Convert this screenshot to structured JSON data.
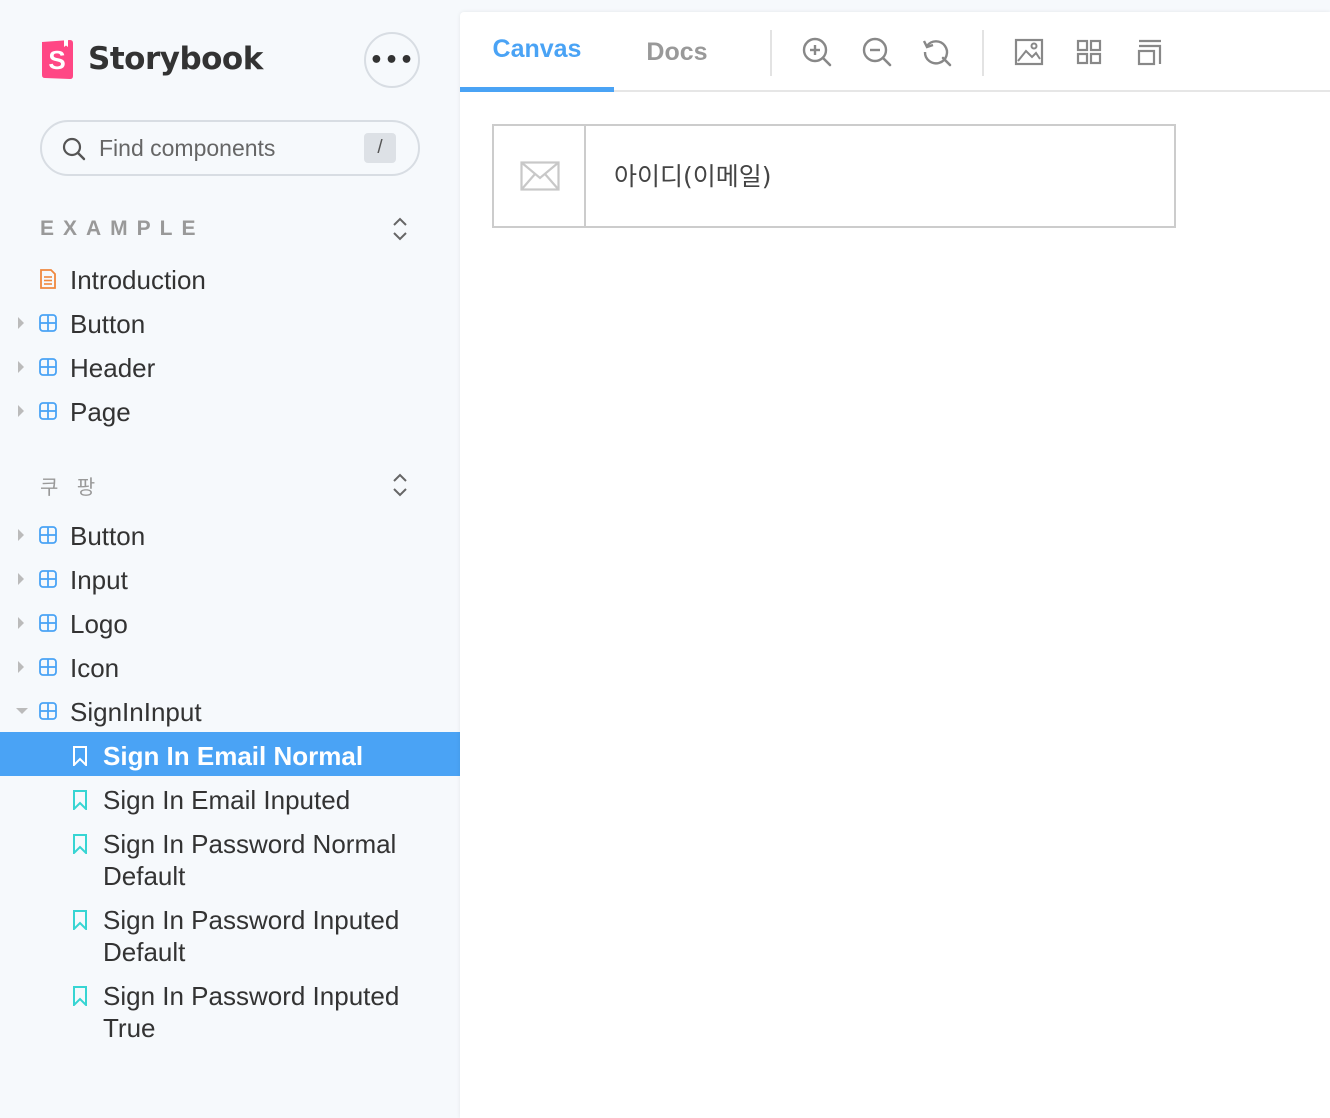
{
  "brand": {
    "name": "Storybook",
    "accent": "#ff4785"
  },
  "search": {
    "placeholder": "Find components",
    "shortcut": "/"
  },
  "groups": [
    {
      "title": "EXAMPLE",
      "items": [
        {
          "label": "Introduction",
          "type": "doc"
        },
        {
          "label": "Button",
          "type": "component"
        },
        {
          "label": "Header",
          "type": "component"
        },
        {
          "label": "Page",
          "type": "component"
        }
      ]
    },
    {
      "title": "쿠 팡",
      "items": [
        {
          "label": "Button",
          "type": "component"
        },
        {
          "label": "Input",
          "type": "component"
        },
        {
          "label": "Logo",
          "type": "component"
        },
        {
          "label": "Icon",
          "type": "component"
        },
        {
          "label": "SignInInput",
          "type": "component",
          "expanded": true
        }
      ]
    }
  ],
  "stories": [
    {
      "label": "Sign In Email Normal",
      "selected": true
    },
    {
      "label": "Sign In Email Inputed"
    },
    {
      "label": "Sign In Password Normal Default"
    },
    {
      "label": "Sign In Password Inputed Default"
    },
    {
      "label": "Sign In Password Inputed True"
    }
  ],
  "toolbar": {
    "tabs": [
      {
        "label": "Canvas",
        "active": true
      },
      {
        "label": "Docs"
      }
    ],
    "icons": [
      "zoom-in-icon",
      "zoom-out-icon",
      "zoom-reset-icon",
      "background-icon",
      "grid-icon",
      "outline-icon"
    ]
  },
  "canvas": {
    "input_text": "아이디(이메일)",
    "input_icon": "mail-icon"
  },
  "colors": {
    "selected": "#4aa3f5",
    "component_icon": "#4aa3f5",
    "doc_icon": "#f0883e",
    "story_icon": "#37d5d3"
  }
}
